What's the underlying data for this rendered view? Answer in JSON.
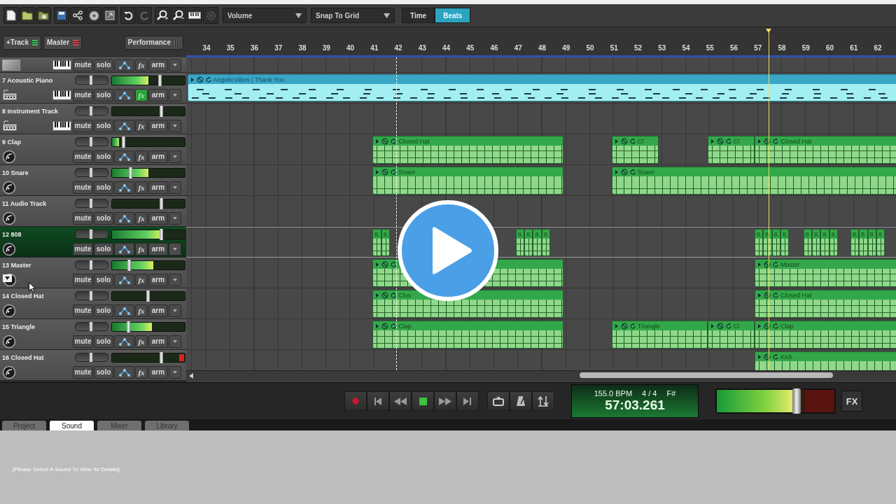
{
  "toolbar": {
    "view_dropdown": "Volume",
    "snap_dropdown": "Snap To Grid",
    "time_modes": [
      {
        "label": "Time",
        "selected": false
      },
      {
        "label": "Beats",
        "selected": true
      }
    ]
  },
  "track_header": {
    "add_track": "+Track",
    "master": "Master",
    "performance": "Performance"
  },
  "ruler": {
    "bars": [
      "34",
      "35",
      "36",
      "37",
      "38",
      "39",
      "40",
      "41",
      "42",
      "43",
      "44",
      "45",
      "46",
      "47",
      "48",
      "49",
      "50",
      "51",
      "52",
      "53",
      "54",
      "55",
      "56",
      "57",
      "58",
      "59",
      "60",
      "61",
      "62"
    ]
  },
  "partial_track": {
    "kind": "video",
    "buttons": [
      {
        "label": "mute",
        "on": false
      },
      {
        "label": "solo",
        "on": false
      },
      {
        "label": "fx",
        "on": false
      },
      {
        "label": "arm",
        "on": false
      }
    ]
  },
  "tracks": [
    {
      "name": "7 Acoustic Piano",
      "kind": "instrument",
      "selected": false,
      "clip_led": false,
      "pan": {
        "level": 0.5
      },
      "volume": {
        "level": 0.66
      },
      "meter": {
        "level": 0.5
      },
      "buttons": [
        {
          "label": "mute",
          "on": false
        },
        {
          "label": "solo",
          "on": false
        },
        {
          "label": "fx",
          "on": true
        },
        {
          "label": "arm",
          "on": false
        }
      ],
      "clips": [
        {
          "kind": "midi",
          "label": "AngelicVibes | Thank You"
        }
      ]
    },
    {
      "name": "8 Instrument Track",
      "kind": "instrument",
      "selected": false,
      "clip_led": false,
      "pan": {
        "level": 0.5
      },
      "volume": {
        "level": 0.68
      },
      "buttons": [
        {
          "label": "mute",
          "on": false
        },
        {
          "label": "solo",
          "on": false
        },
        {
          "label": "fx",
          "on": false
        },
        {
          "label": "arm",
          "on": false
        }
      ]
    },
    {
      "name": "9 Clap",
      "kind": "audio",
      "selected": false,
      "clip_led": false,
      "pan": {
        "level": 0.5
      },
      "volume": {
        "level": 0.16
      },
      "meter": {
        "level": 0.1
      },
      "buttons": [
        {
          "label": "mute",
          "on": false
        },
        {
          "label": "solo",
          "on": false
        },
        {
          "label": "fx",
          "on": false
        },
        {
          "label": "arm",
          "on": false
        }
      ],
      "clips": [
        {
          "kind": "audio",
          "label": "Closed Hat"
        },
        {
          "kind": "audio",
          "label": "Cl"
        },
        {
          "kind": "audio",
          "label": "Cl"
        },
        {
          "kind": "audio",
          "label": "Closed Hat"
        }
      ]
    },
    {
      "name": "10 Snare",
      "kind": "audio",
      "selected": false,
      "clip_led": false,
      "pan": {
        "level": 0.5
      },
      "volume": {
        "level": 0.26
      },
      "meter": {
        "level": 0.5
      },
      "buttons": [
        {
          "label": "mute",
          "on": false
        },
        {
          "label": "solo",
          "on": false
        },
        {
          "label": "fx",
          "on": false
        },
        {
          "label": "arm",
          "on": false
        }
      ],
      "clips": [
        {
          "kind": "audio",
          "label": "Snare"
        },
        {
          "kind": "audio",
          "label": "Snare"
        }
      ]
    },
    {
      "name": "11 Audio Track",
      "kind": "audio",
      "selected": false,
      "clip_led": false,
      "pan": {
        "level": 0.5
      },
      "volume": {
        "level": 0.68
      },
      "buttons": [
        {
          "label": "mute",
          "on": false
        },
        {
          "label": "solo",
          "on": false
        },
        {
          "label": "fx",
          "on": false
        },
        {
          "label": "arm",
          "on": false
        }
      ]
    },
    {
      "name": "12 808",
      "kind": "audio",
      "selected": true,
      "clip_led": false,
      "pan": {
        "level": 0.5
      },
      "volume": {
        "level": 0.68
      },
      "meter": {
        "level": 0.68
      },
      "buttons": [
        {
          "label": "mute",
          "on": false
        },
        {
          "label": "solo",
          "on": false
        },
        {
          "label": "fx",
          "on": false
        },
        {
          "label": "arm",
          "on": false
        }
      ],
      "clips": [
        {
          "kind": "audio",
          "label": "8."
        },
        {
          "kind": "audio",
          "label": "8."
        },
        {
          "kind": "audio",
          "label": "8."
        },
        {
          "kind": "audio",
          "label": "8."
        },
        {
          "kind": "audio",
          "label": "8."
        },
        {
          "kind": "audio",
          "label": "8."
        },
        {
          "kind": "audio",
          "label": "8."
        },
        {
          "kind": "audio",
          "label": "8."
        },
        {
          "kind": "audio",
          "label": "8."
        },
        {
          "kind": "audio",
          "label": "8."
        },
        {
          "kind": "audio",
          "label": "8"
        },
        {
          "kind": "audio",
          "label": "8."
        },
        {
          "kind": "audio",
          "label": "8"
        },
        {
          "kind": "audio",
          "label": "8."
        },
        {
          "kind": "audio",
          "label": "8."
        },
        {
          "kind": "audio",
          "label": "8"
        },
        {
          "kind": "audio",
          "label": "8"
        },
        {
          "kind": "audio",
          "label": "8"
        }
      ]
    },
    {
      "name": "13 Master",
      "kind": "master",
      "selected": false,
      "clip_led": false,
      "pan": {
        "level": 0.5
      },
      "volume": {
        "level": 0.24
      },
      "meter": {
        "level": 0.57
      },
      "buttons": [
        {
          "label": "mute",
          "on": false
        },
        {
          "label": "solo",
          "on": false
        },
        {
          "label": "fx",
          "on": false
        },
        {
          "label": "arm",
          "on": false
        }
      ],
      "clips": [
        {
          "kind": "audio"
        },
        {
          "kind": "audio",
          "label": "Master"
        }
      ]
    },
    {
      "name": "14 Closed Hat",
      "kind": "audio",
      "selected": false,
      "clip_led": false,
      "pan": {
        "level": 0.5
      },
      "volume": {
        "level": 0.5
      },
      "buttons": [
        {
          "label": "mute",
          "on": false
        },
        {
          "label": "solo",
          "on": false
        },
        {
          "label": "fx",
          "on": false
        },
        {
          "label": "arm",
          "on": false
        }
      ],
      "clips": [
        {
          "kind": "audio",
          "label": "Clos"
        },
        {
          "kind": "audio",
          "label": "Closed Hat"
        }
      ]
    },
    {
      "name": "15 Triangle",
      "kind": "audio",
      "selected": false,
      "clip_led": false,
      "pan": {
        "level": 0.5
      },
      "volume": {
        "level": 0.23
      },
      "meter": {
        "level": 0.55
      },
      "buttons": [
        {
          "label": "mute",
          "on": false
        },
        {
          "label": "solo",
          "on": false
        },
        {
          "label": "fx",
          "on": false
        },
        {
          "label": "arm",
          "on": false
        }
      ],
      "clips": [
        {
          "kind": "audio",
          "label": "Clap"
        },
        {
          "kind": "audio",
          "label": "Triangle"
        },
        {
          "kind": "audio",
          "label": "Cl"
        },
        {
          "kind": "audio",
          "label": "Clap"
        }
      ]
    },
    {
      "name": "16 Closed Hat",
      "kind": "audio",
      "selected": false,
      "clip_led": true,
      "pan": {
        "level": 0.5
      },
      "volume": {
        "level": 0.68
      },
      "buttons": [
        {
          "label": "mute",
          "on": false
        },
        {
          "label": "solo",
          "on": false
        },
        {
          "label": "fx",
          "on": false
        },
        {
          "label": "arm",
          "on": false
        }
      ],
      "clips": [
        {
          "kind": "audio",
          "label": "Kick"
        }
      ]
    }
  ],
  "transport": {
    "display": {
      "tempo": "155.0 BPM",
      "meter": "4 / 4",
      "key": "F#",
      "position": "57:03.261"
    },
    "master_volume": {
      "level": 0.68
    },
    "fx_button": "FX"
  },
  "bottom_tabs": [
    {
      "label": "Project",
      "selected": false
    },
    {
      "label": "Sound",
      "selected": true
    },
    {
      "label": "Mixer",
      "selected": false
    },
    {
      "label": "Library",
      "selected": false
    }
  ],
  "details_message": "[Please Select A Sound To View Its Details]"
}
